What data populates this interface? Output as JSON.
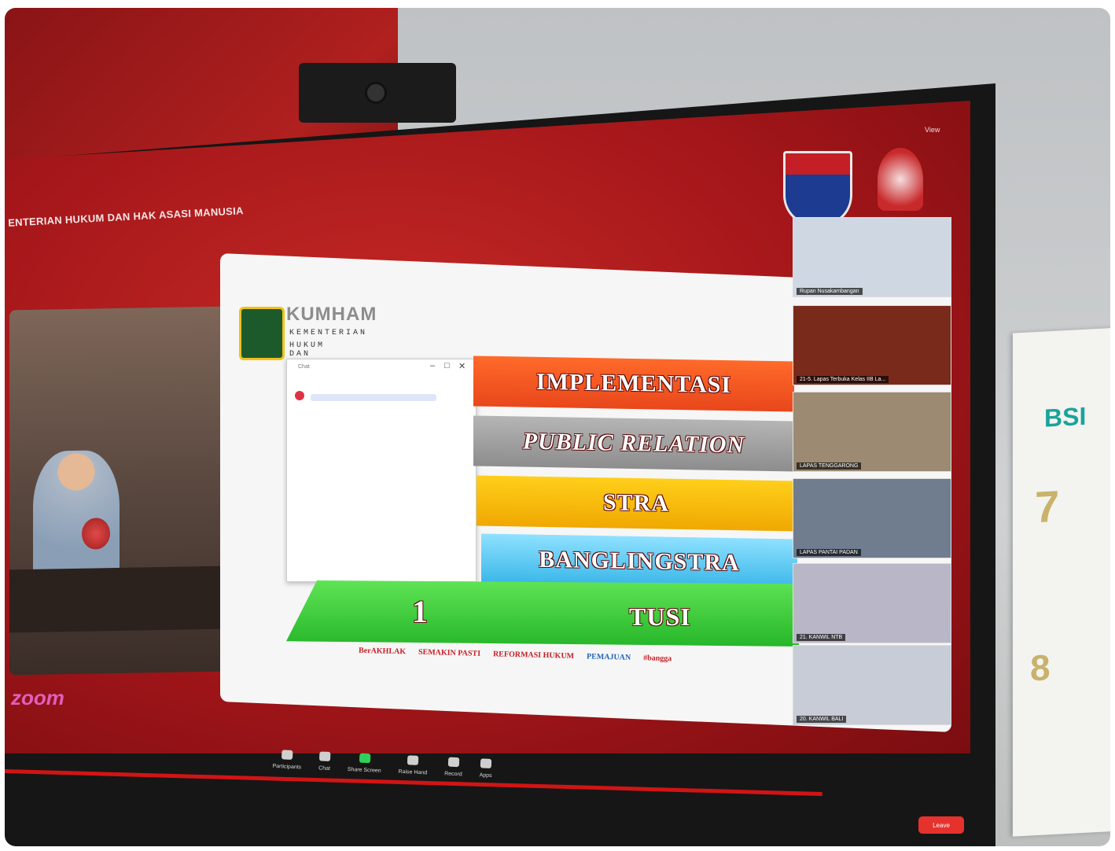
{
  "header": {
    "ministry": "ENTERIAN HUKUM DAN HAK ASASI MANUSIA",
    "view_label": "View"
  },
  "speaker": {
    "brand": "zoom"
  },
  "slide": {
    "org": {
      "short": "KUMHAM",
      "line1": "KEMENTERIAN",
      "line2": "HUKUM DAN HAM"
    },
    "chat": {
      "title": "Chat",
      "min": "–",
      "max": "□",
      "close": "✕"
    },
    "bands": [
      {
        "label": "IMPLEMENTASI"
      },
      {
        "label": "PUBLIC RELATION"
      },
      {
        "label": "STRA"
      },
      {
        "label": "BANGLINGSTRA"
      },
      {
        "number": "1",
        "label": "TUSI"
      }
    ],
    "footer_logos": [
      "BerAKHLAK",
      "SEMAKIN PASTI",
      "REFORMASI HUKUM",
      "PEMAJUAN",
      "#bangga"
    ]
  },
  "gallery": [
    {
      "caption": "Rupan Nusakambangan",
      "bg": "#cfd7e3"
    },
    {
      "caption": "21-5. Lapas Terbuka Kelas IIB La...",
      "bg": "#7a2a1a"
    },
    {
      "caption": "LAPAS TENGGARONG",
      "bg": "#9c8a72"
    },
    {
      "caption": "LAPAS PANTAI PADAN",
      "bg": "#6f7d8f"
    },
    {
      "caption": "21. KANWIL NTB",
      "bg": "#b9b6c7"
    },
    {
      "caption": "20. KANWIL BALI",
      "bg": "#c7ccd6"
    }
  ],
  "zoom_toolbar": [
    "Participants",
    "Chat",
    "Share Screen",
    "Raise Hand",
    "Record",
    "Apps"
  ],
  "end_button": "Leave",
  "calendar": {
    "brand": "BSI",
    "n1": "7",
    "n2": "8"
  }
}
